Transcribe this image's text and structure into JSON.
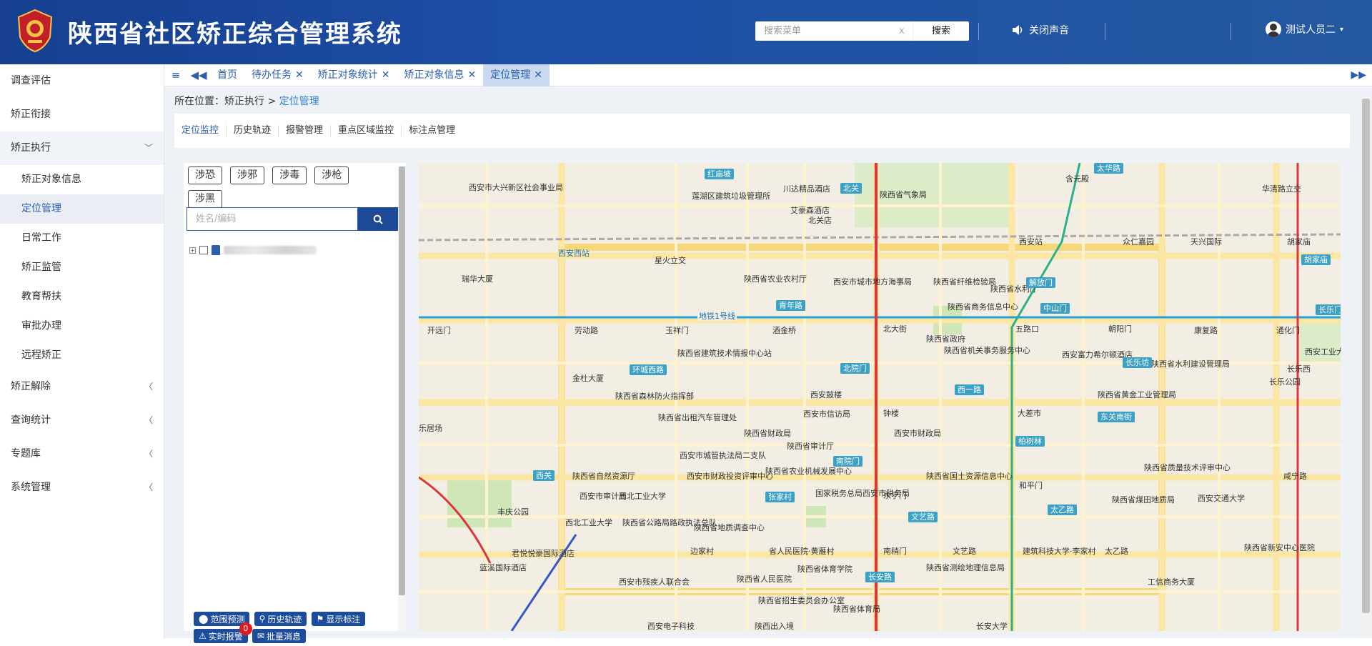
{
  "app": {
    "title": "陕西省社区矫正综合管理系统"
  },
  "header": {
    "search_placeholder": "搜索菜单",
    "clear": "x",
    "search_button": "搜索",
    "sound_label": "关闭声音",
    "user_name": "测试人员二"
  },
  "sidebar": {
    "items": [
      {
        "label": "调查评估"
      },
      {
        "label": "矫正衔接"
      },
      {
        "label": "矫正执行",
        "open": true
      },
      {
        "label": "矫正解除"
      },
      {
        "label": "查询统计"
      },
      {
        "label": "专题库"
      },
      {
        "label": "系统管理"
      }
    ],
    "sub_items": [
      {
        "label": "矫正对象信息"
      },
      {
        "label": "定位管理",
        "active": true
      },
      {
        "label": "日常工作"
      },
      {
        "label": "矫正监管"
      },
      {
        "label": "教育帮扶"
      },
      {
        "label": "审批办理"
      },
      {
        "label": "远程矫正"
      }
    ]
  },
  "tabs": [
    {
      "label": "首页",
      "closable": false
    },
    {
      "label": "待办任务",
      "closable": true
    },
    {
      "label": "矫正对象统计",
      "closable": true
    },
    {
      "label": "矫正对象信息",
      "closable": true
    },
    {
      "label": "定位管理",
      "closable": true,
      "active": true
    }
  ],
  "breadcrumb": {
    "prefix": "所在位置：",
    "parent": "矫正执行",
    "sep": ">",
    "current": "定位管理"
  },
  "subnav": [
    {
      "label": "定位监控",
      "active": true
    },
    {
      "label": "历史轨迹"
    },
    {
      "label": "报警管理"
    },
    {
      "label": "重点区域监控"
    },
    {
      "label": "标注点管理"
    }
  ],
  "filters": [
    "涉恐",
    "涉邪",
    "涉毒",
    "涉枪",
    "涉黑"
  ],
  "search": {
    "placeholder": "姓名/编码"
  },
  "actions": [
    {
      "label": "范围预测"
    },
    {
      "label": "历史轨迹"
    },
    {
      "label": "显示标注"
    },
    {
      "label": "实时报警",
      "badge": "0"
    },
    {
      "label": "批量消息"
    }
  ],
  "map": {
    "metro_line": "地铁1号线",
    "road_labels": [
      "红庙坡",
      "北关",
      "太华路",
      "解放门",
      "中山门",
      "青年路",
      "环城西路",
      "北院门",
      "长乐坊",
      "西一路",
      "东关南街",
      "柏树林",
      "南院门",
      "西关",
      "张家村",
      "文艺路",
      "太乙路",
      "长安路",
      "胡家庙",
      "长乐门"
    ],
    "places": [
      "西安市大兴新区社会事业局",
      "莲湖区建筑垃圾管理所",
      "川达精品酒店",
      "艾豪森酒店",
      "北关店",
      "陕西省气象局",
      "含元殿",
      "华清路立交",
      "西安西站",
      "星火立交",
      "西安站",
      "众仁嘉园",
      "天兴国际",
      "瑞华大厦",
      "陕西省农业农村厅",
      "西安市城市地方海事局",
      "陕西省纤维检验局",
      "陕西省水利厅",
      "陕西省商务信息中心",
      "开远门",
      "劳动路",
      "玉祥门",
      "酒金桥",
      "北大街",
      "五路口",
      "朝阳门",
      "康复路",
      "通化门",
      "陕西省建筑技术情报中心站",
      "陕西省政府",
      "陕西省机关事务服务中心",
      "西安富力希尔顿酒店",
      "陕西省水利建设管理局",
      "金杜大厦",
      "陕西省森林防火指挥部",
      "西安鼓楼",
      "钟楼",
      "大差市",
      "陕西省黄金工业管理局",
      "长乐公园",
      "陕西省出租汽车管理处",
      "西安市信访局",
      "西安市财政局",
      "陕西省财政局",
      "西安市城管执法局二支队",
      "陕西省审计厅",
      "陕西省自然资源厅",
      "西安市财政投资评审中心",
      "陕西省农业机械发展中心",
      "陕西省国土资源信息中心",
      "和平门",
      "陕西省质量技术评审中心",
      "咸宁路",
      "丰庆公园",
      "西安市审计局",
      "西北工业大学",
      "国家税务总局西安市税务局",
      "永宁门",
      "陕西省煤田地质局",
      "西安交通大学",
      "西北工业大学",
      "陕西省公路局路政执法总队",
      "陕西省地质调查中心",
      "边家村",
      "省人民医院·黄雁村",
      "南稍门",
      "文艺路",
      "建筑科技大学·李家村",
      "太乙路",
      "陕西省测绘地理信息局",
      "陕西省体育学院",
      "陕西省人民医院",
      "西安市残疾人联合会",
      "陕西省招生委员会办公室",
      "陕西省体育局",
      "工信商务大厦",
      "长安大学",
      "西安电子科技",
      "陕西出入境",
      "乐居场",
      "蓝溪国际酒店",
      "君悦悦豪国际酒店",
      "陕西省新安中心医院",
      "胡家庙",
      "长乐西",
      "西安工业大学"
    ]
  },
  "colors": {
    "header_bg": "#1d4fa6",
    "accent": "#2a5fb0",
    "metro_line_1": "#2a9fd6",
    "metro_line_2": "#d9363e",
    "badge": "#e01b1b"
  }
}
